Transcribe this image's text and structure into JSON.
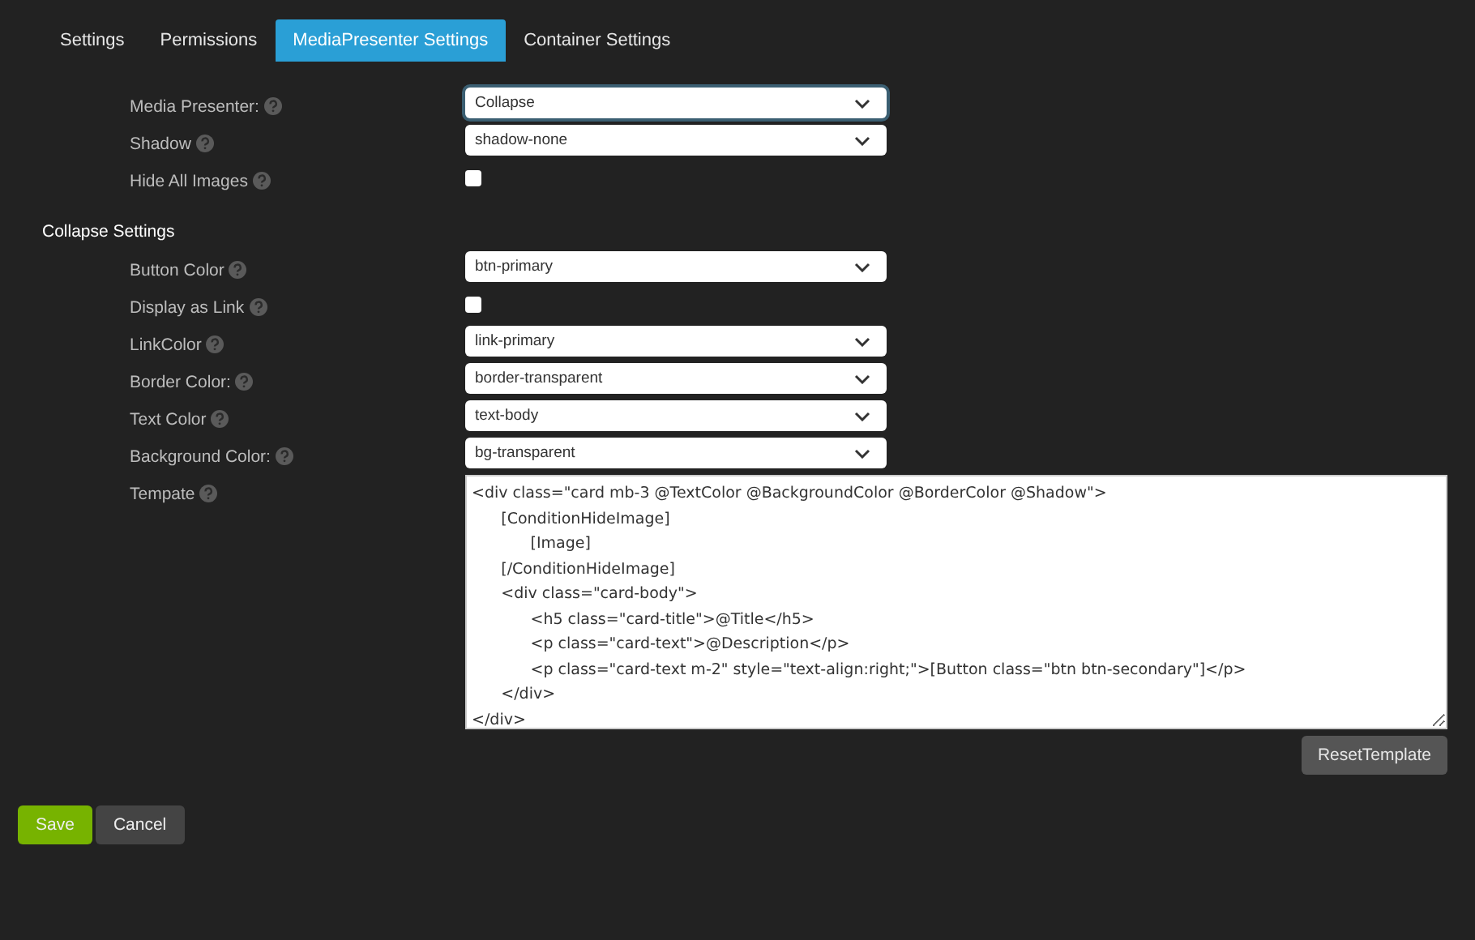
{
  "tabs": [
    {
      "label": "Settings",
      "selected": false
    },
    {
      "label": "Permissions",
      "selected": false
    },
    {
      "label": "MediaPresenter Settings",
      "selected": true
    },
    {
      "label": "Container Settings",
      "selected": false
    }
  ],
  "sections": [
    {
      "fields": [
        {
          "kind": "select",
          "label": "Media Presenter:",
          "value": "Collapse"
        },
        {
          "kind": "select",
          "label": "Shadow",
          "value": "shadow-none"
        },
        {
          "kind": "checkbox",
          "label": "Hide All Images",
          "checked": false
        }
      ]
    },
    {
      "heading": "Collapse Settings",
      "fields": [
        {
          "kind": "select",
          "label": "Button Color",
          "value": "btn-primary"
        },
        {
          "kind": "checkbox",
          "label": "Display as Link",
          "checked": false
        },
        {
          "kind": "select",
          "label": "LinkColor",
          "value": "link-primary"
        },
        {
          "kind": "select",
          "label": "Border Color:",
          "value": "border-transparent"
        },
        {
          "kind": "select",
          "label": "Text Color",
          "value": "text-body"
        },
        {
          "kind": "select",
          "label": "Background Color:",
          "value": "bg-transparent"
        },
        {
          "kind": "textarea",
          "label": "Tempate",
          "value": "<div class=\"card mb-3 @TextColor @BackgroundColor @BorderColor @Shadow\">\n\t[ConditionHideImage]\n\t\t[Image]\n\t[/ConditionHideImage]\n\t<div class=\"card-body\">\n\t\t<h5 class=\"card-title\">@Title</h5>\n\t\t<p class=\"card-text\">@Description</p>\n\t\t<p class=\"card-text m-2\" style=\"text-align:right;\">[Button class=\"btn btn-secondary\"]</p>\n\t</div>\n</div>"
        }
      ]
    }
  ],
  "reset_button": "ResetTemplate",
  "buttons": [
    {
      "kind": "primary",
      "label": "Save"
    },
    {
      "kind": "secondary",
      "label": "Cancel"
    }
  ]
}
